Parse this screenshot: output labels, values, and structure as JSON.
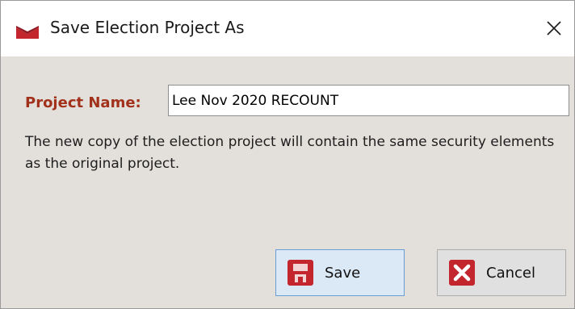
{
  "window": {
    "title": "Save Election Project As",
    "app_icon": "red-ballot-envelope-icon",
    "close_icon": "close-icon",
    "close_glyph": "✕"
  },
  "form": {
    "label": "Project Name:",
    "value": "Lee Nov 2020 RECOUNT",
    "description": "The new copy of the election project will contain the same security elements as the original project."
  },
  "buttons": {
    "save_label": "Save",
    "save_icon": "floppy-disk-icon",
    "cancel_label": "Cancel",
    "cancel_icon": "red-x-icon"
  },
  "colors": {
    "label": "#a2311c",
    "accent_red": "#c4262e",
    "dialog_background": "#e3e0dc",
    "save_button_border": "#6a9fd4"
  }
}
